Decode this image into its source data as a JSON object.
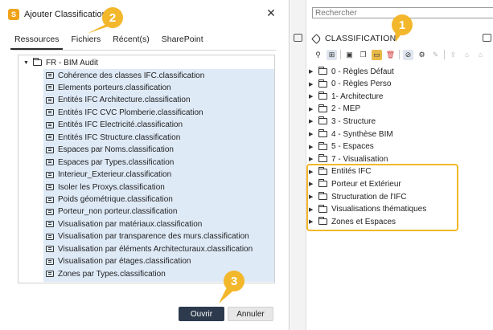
{
  "dialog": {
    "title": "Ajouter Classifications",
    "app_logo_letter": "S",
    "close_glyph": "✕",
    "tabs": [
      {
        "label": "Ressources",
        "active": true
      },
      {
        "label": "Fichiers",
        "active": false
      },
      {
        "label": "Récent(s)",
        "active": false
      },
      {
        "label": "SharePoint",
        "active": false
      }
    ],
    "tree_root": "FR - BIM Audit",
    "items": [
      "Cohérence des classes IFC.classification",
      "Elements porteurs.classification",
      "Entités IFC Architecture.classification",
      "Entités IFC CVC Plomberie.classification",
      "Entités IFC Electricité.classification",
      "Entités IFC Structure.classification",
      "Espaces par Noms.classification",
      "Espaces par Types.classification",
      "Interieur_Exterieur.classification",
      "Isoler les Proxys.classification",
      "Poids géométrique.classification",
      "Porteur_non porteur.classification",
      "Visualisation par matériaux.classification",
      "Visualisation par transparence des murs.classification",
      "Visualisation par éléments Architecturaux.classification",
      "Visualisation par étages.classification",
      "Zones par Types.classification"
    ],
    "ok_label": "Ouvrir",
    "cancel_label": "Annuler"
  },
  "right_panel": {
    "search_placeholder": "Rechercher",
    "header": "CLASSIFICATION",
    "items": [
      "0 - Règles Défaut",
      "0 - Règles Perso",
      "1- Architecture",
      "2 - MEP",
      "3 - Structure",
      "4 - Synthèse BIM",
      "5 - Espaces",
      "7 - Visualisation",
      "Entités IFC",
      "Porteur et Extérieur",
      "Structuration de l'IFC",
      "Visualisations thématiques",
      "Zones et Espaces"
    ]
  },
  "callouts": [
    "1",
    "2",
    "3"
  ],
  "colors": {
    "accent": "#f3b72b",
    "selection": "#dfeaf7",
    "primary_button": "#2d3a4d"
  }
}
